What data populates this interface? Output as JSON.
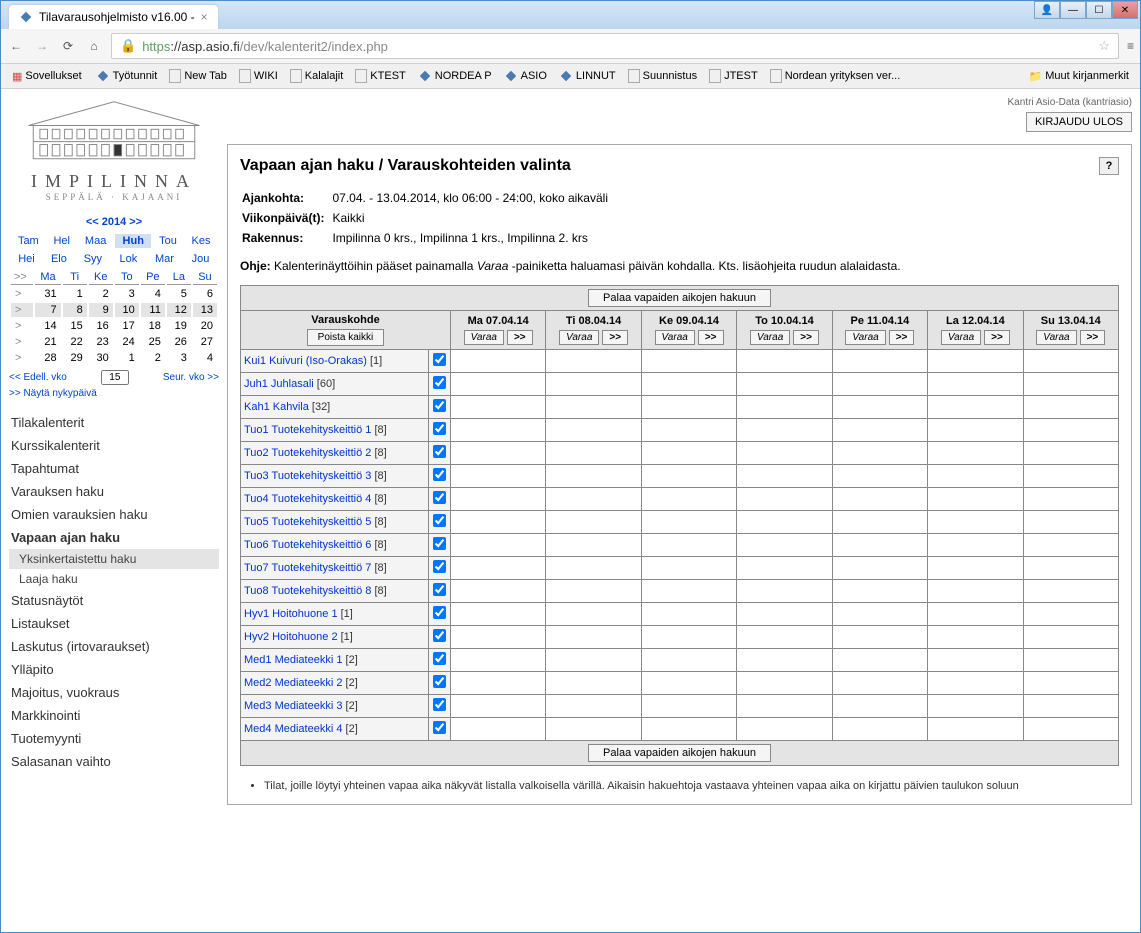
{
  "browser": {
    "tab_title": "Tilavarausohjelmisto v16.00 -",
    "url_scheme": "https",
    "url_host": "://asp.asio.fi",
    "url_path": "/dev/kalenterit2/index.php"
  },
  "bookmarks": {
    "apps": "Sovellukset",
    "items": [
      "Työtunnit",
      "New Tab",
      "WIKI",
      "Kalalajit",
      "KTEST",
      "NORDEA P",
      "ASIO",
      "LINNUT",
      "Suunnistus",
      "JTEST",
      "Nordean yrityksen ver..."
    ],
    "other": "Muut kirjanmerkit"
  },
  "logo": {
    "name": "IMPILINNA",
    "sub": "SEPPÄLÄ · KAJAANI"
  },
  "user": {
    "label": "Kantri Asio-Data (kantriasio)",
    "logout": "KIRJAUDU ULOS"
  },
  "cal": {
    "year_label": "<< 2014 >>",
    "months1": [
      "Tam",
      "Hel",
      "Maa",
      "Huh",
      "Tou",
      "Kes"
    ],
    "months2": [
      "Hei",
      "Elo",
      "Syy",
      "Lok",
      "Mar",
      "Jou"
    ],
    "current_month_idx": 3,
    "day_heads": [
      "Ma",
      "Ti",
      "Ke",
      "To",
      "Pe",
      "La",
      "Su"
    ],
    "weeks": [
      {
        "mark": ">",
        "days": [
          "31",
          "1",
          "2",
          "3",
          "4",
          "5",
          "6"
        ]
      },
      {
        "mark": ">",
        "days": [
          "7",
          "8",
          "9",
          "10",
          "11",
          "12",
          "13"
        ],
        "hl": true
      },
      {
        "mark": ">",
        "days": [
          "14",
          "15",
          "16",
          "17",
          "18",
          "19",
          "20"
        ]
      },
      {
        "mark": ">",
        "days": [
          "21",
          "22",
          "23",
          "24",
          "25",
          "26",
          "27"
        ]
      },
      {
        "mark": ">",
        "days": [
          "28",
          "29",
          "30",
          "1",
          "2",
          "3",
          "4"
        ]
      }
    ],
    "prev": "<< Edell. vko",
    "next": "Seur. vko >>",
    "weeknum": "15",
    "show_today": ">> Näytä nykypäivä",
    "today_cell": "15"
  },
  "nav": {
    "items": [
      {
        "label": "Tilakalenterit"
      },
      {
        "label": "Kurssikalenterit"
      },
      {
        "label": "Tapahtumat"
      },
      {
        "label": "Varauksen haku"
      },
      {
        "label": "Omien varauksien haku"
      },
      {
        "label": "Vapaan ajan haku",
        "active": true,
        "subs": [
          {
            "label": "Yksinkertaistettu haku",
            "sel": true
          },
          {
            "label": "Laaja haku"
          }
        ]
      },
      {
        "label": "Statusnäytöt"
      },
      {
        "label": "Listaukset"
      },
      {
        "label": "Laskutus (irtovaraukset)"
      },
      {
        "label": "Ylläpito"
      },
      {
        "label": "Majoitus, vuokraus"
      },
      {
        "label": "Markkinointi"
      },
      {
        "label": "Tuotemyynti"
      },
      {
        "label": "Salasanan vaihto"
      }
    ]
  },
  "main": {
    "title": "Vapaan ajan haku / Varauskohteiden valinta",
    "help": "?",
    "rows": [
      {
        "k": "Ajankohta:",
        "v": "07.04. - 13.04.2014, klo 06:00 - 24:00, koko aikaväli"
      },
      {
        "k": "Viikonpäivä(t):",
        "v": "Kaikki"
      },
      {
        "k": "Rakennus:",
        "v": "Impilinna 0 krs., Impilinna 1 krs., Impilinna 2. krs"
      }
    ],
    "ohje_label": "Ohje:",
    "ohje_pre": " Kalenterinäyttöihin pääset painamalla ",
    "ohje_em": "Varaa ",
    "ohje_post": "-painiketta haluamasi päivän kohdalla. Kts. lisäohjeita ruudun alalaidasta.",
    "back_btn": "Palaa vapaiden aikojen hakuun",
    "col0_head": "Varauskohde",
    "col0_btn": "Poista kaikki",
    "day_cols": [
      "Ma 07.04.14",
      "Ti 08.04.14",
      "Ke 09.04.14",
      "To 10.04.14",
      "Pe 11.04.14",
      "La 12.04.14",
      "Su 13.04.14"
    ],
    "varaa": "Varaa",
    "arrow": ">>",
    "rooms": [
      {
        "name": "Kui1 Kuivuri (Iso-Orakas)",
        "cap": "1"
      },
      {
        "name": "Juh1 Juhlasali",
        "cap": "60"
      },
      {
        "name": "Kah1 Kahvila",
        "cap": "32"
      },
      {
        "name": "Tuo1 Tuotekehityskeittiö 1",
        "cap": "8"
      },
      {
        "name": "Tuo2 Tuotekehityskeittiö 2",
        "cap": "8"
      },
      {
        "name": "Tuo3 Tuotekehityskeittiö 3",
        "cap": "8"
      },
      {
        "name": "Tuo4 Tuotekehityskeittiö 4",
        "cap": "8"
      },
      {
        "name": "Tuo5 Tuotekehityskeittiö 5",
        "cap": "8"
      },
      {
        "name": "Tuo6 Tuotekehityskeittiö 6",
        "cap": "8"
      },
      {
        "name": "Tuo7 Tuotekehityskeittiö 7",
        "cap": "8"
      },
      {
        "name": "Tuo8 Tuotekehityskeittiö 8",
        "cap": "8"
      },
      {
        "name": "Hyv1 Hoitohuone 1",
        "cap": "1"
      },
      {
        "name": "Hyv2 Hoitohuone 2",
        "cap": "1"
      },
      {
        "name": "Med1 Mediateekki 1",
        "cap": "2"
      },
      {
        "name": "Med2 Mediateekki 2",
        "cap": "2"
      },
      {
        "name": "Med3 Mediateekki 3",
        "cap": "2"
      },
      {
        "name": "Med4 Mediateekki 4",
        "cap": "2"
      }
    ],
    "footnote": "Tilat, joille löytyi yhteinen vapaa aika näkyvät listalla valkoisella värillä. Aikaisin hakuehtoja vastaava yhteinen vapaa aika on kirjattu päivien taulukon soluun"
  }
}
